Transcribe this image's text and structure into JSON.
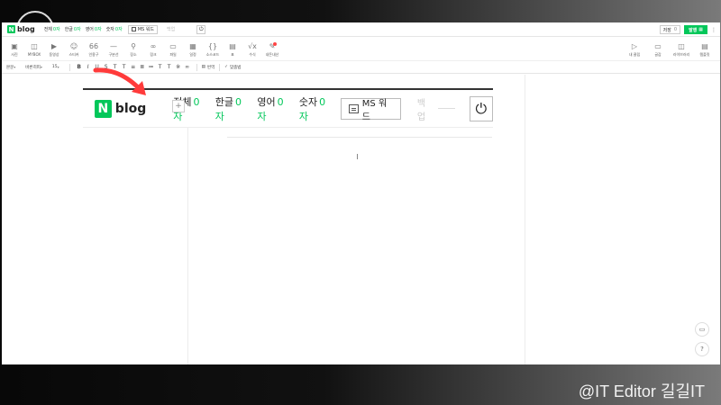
{
  "topbar": {
    "logo_n": "N",
    "logo_text": "blog",
    "counts": [
      {
        "label": "전체",
        "value": "0자"
      },
      {
        "label": "한글",
        "value": "0자"
      },
      {
        "label": "영어",
        "value": "0자"
      },
      {
        "label": "숫자",
        "value": "0자"
      }
    ],
    "msword_label": "MS 워드",
    "backup_label": "백업",
    "save_label": "저장",
    "save_count": "0",
    "publish_label": "발행"
  },
  "insert_tools": [
    {
      "icon": "photo-icon",
      "glyph": "▣",
      "label": "사진"
    },
    {
      "icon": "mybox-icon",
      "glyph": "◫",
      "label": "MYBOX"
    },
    {
      "icon": "video-icon",
      "glyph": "▶",
      "label": "동영상"
    },
    {
      "icon": "sticker-icon",
      "glyph": "☺",
      "label": "스티커"
    },
    {
      "icon": "quote-icon",
      "glyph": "66",
      "label": "인용구"
    },
    {
      "icon": "divider-icon",
      "glyph": "—",
      "label": "구분선"
    },
    {
      "icon": "place-icon",
      "glyph": "⚲",
      "label": "장소"
    },
    {
      "icon": "link-icon",
      "glyph": "∞",
      "label": "링크"
    },
    {
      "icon": "file-icon",
      "glyph": "▭",
      "label": "파일"
    },
    {
      "icon": "schedule-icon",
      "glyph": "▦",
      "label": "일정"
    },
    {
      "icon": "sourcecode-icon",
      "glyph": "{}",
      "label": "소스코드"
    },
    {
      "icon": "table-icon",
      "glyph": "▤",
      "label": "표"
    },
    {
      "icon": "formula-icon",
      "glyph": "√x",
      "label": "수식"
    },
    {
      "icon": "blog-market-icon",
      "glyph": "✎",
      "label": "내돈내산"
    }
  ],
  "insert_tools_right": [
    {
      "icon": "my-clip-icon",
      "glyph": "▷",
      "label": "내 클립"
    },
    {
      "icon": "template-icon",
      "glyph": "▭",
      "label": "글감"
    },
    {
      "icon": "library-icon",
      "glyph": "◫",
      "label": "라이브러리"
    },
    {
      "icon": "template2-icon",
      "glyph": "▤",
      "label": "템플릿"
    }
  ],
  "formatbar": {
    "style": "본문",
    "font": "바른히피",
    "size": "15",
    "buttons": [
      "B",
      "I",
      "U",
      "S",
      "T",
      "T",
      "≡",
      "≣",
      "≔",
      "T",
      "T",
      "※",
      "∞"
    ],
    "translate_label": "번역",
    "spellcheck_label": "맞춤법"
  },
  "editor": {
    "plus": "+",
    "counts": [
      {
        "label": "전체",
        "value": "0자"
      },
      {
        "label": "한글",
        "value": "0자"
      },
      {
        "label": "영어",
        "value": "0자"
      },
      {
        "label": "숫자",
        "value": "0자"
      }
    ],
    "msword_label": "MS 워드",
    "backup_label": "백업",
    "backup_placeholder": "",
    "logo_n": "N",
    "logo_text": "blog"
  },
  "float": {
    "screen": "▭",
    "help": "?"
  },
  "watermark": "@IT Editor 길길IT",
  "colors": {
    "accent": "#03c75a",
    "annotation": "#ff3b3b"
  }
}
